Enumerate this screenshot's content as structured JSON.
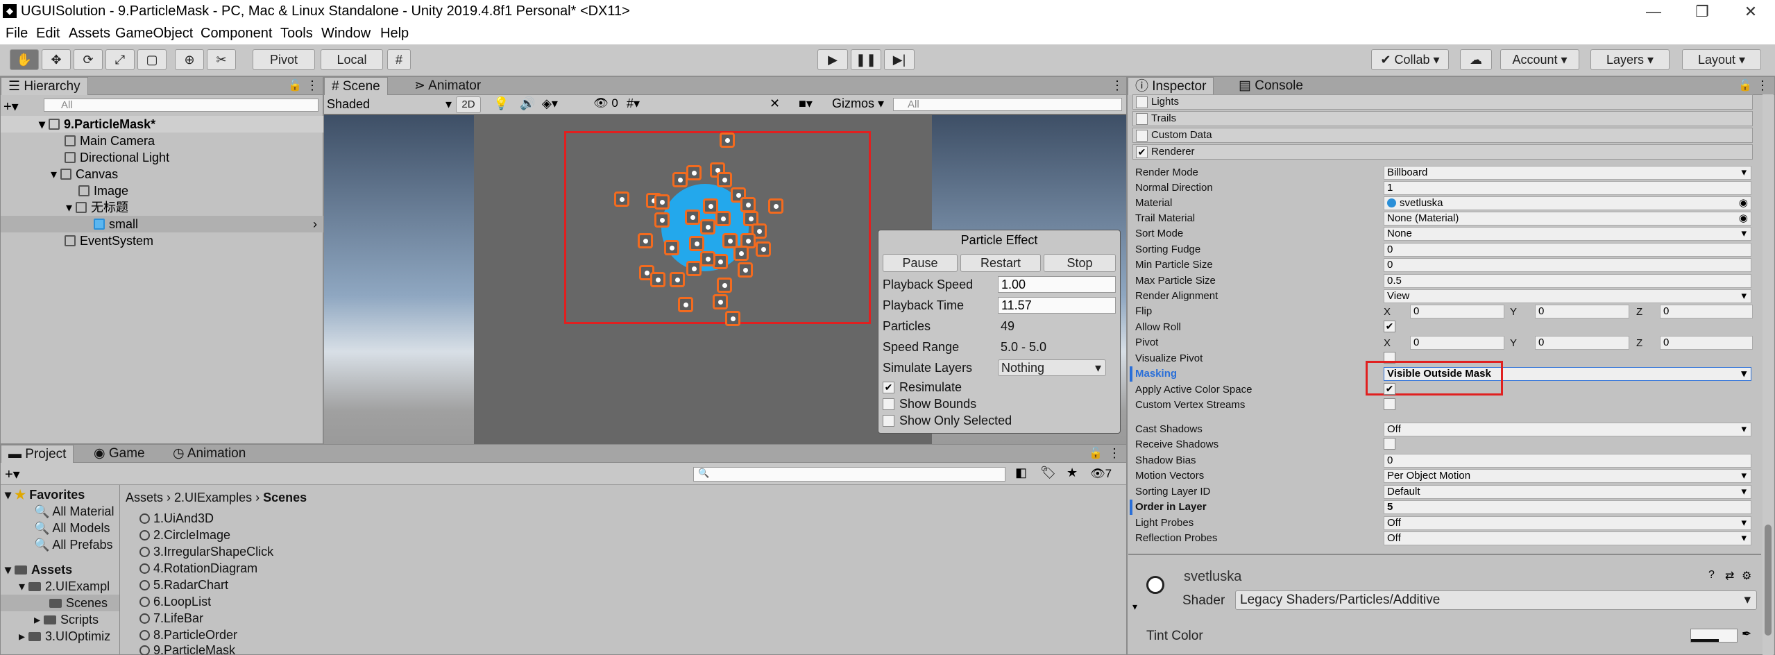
{
  "window": {
    "title": "UGUISolution - 9.ParticleMask - PC, Mac & Linux Standalone - Unity 2019.4.8f1 Personal* <DX11>"
  },
  "menu": [
    "File",
    "Edit",
    "Assets",
    "GameObject",
    "Component",
    "Tools",
    "Window",
    "Help"
  ],
  "toolbar": {
    "pivot": "Pivot",
    "local": "Local",
    "collab": "Collab",
    "account": "Account",
    "layers": "Layers",
    "layout": "Layout"
  },
  "hierarchy": {
    "tab": "Hierarchy",
    "search_placeholder": "All",
    "scene": "9.ParticleMask*",
    "items": [
      "Main Camera",
      "Directional Light",
      "Canvas",
      "Image",
      "无标题",
      "small",
      "EventSystem"
    ]
  },
  "scene_view": {
    "tabs": [
      "Scene",
      "Animator"
    ],
    "shading": "Shaded",
    "mode_2d": "2D",
    "hidden_count": "0",
    "gizmos": "Gizmos",
    "search_placeholder": "All"
  },
  "particle_effect": {
    "title": "Particle Effect",
    "buttons": [
      "Pause",
      "Restart",
      "Stop"
    ],
    "playback_speed_label": "Playback Speed",
    "playback_speed": "1.00",
    "playback_time_label": "Playback Time",
    "playback_time": "11.57",
    "particles_label": "Particles",
    "particles": "49",
    "speed_range_label": "Speed Range",
    "speed_range": "5.0 - 5.0",
    "simulate_layers_label": "Simulate Layers",
    "simulate_layers": "Nothing",
    "resimulate": "Resimulate",
    "show_bounds": "Show Bounds",
    "show_only_selected": "Show Only Selected"
  },
  "project": {
    "tabs": [
      "Project",
      "Game",
      "Animation"
    ],
    "hidden_count": "7",
    "favorites": "Favorites",
    "favorite_items": [
      "All Material",
      "All Models",
      "All Prefabs"
    ],
    "assets": "Assets",
    "tree": [
      "2.UIExampl",
      "Scenes",
      "Scripts",
      "3.UIOptimiz"
    ],
    "breadcrumb": [
      "Assets",
      "2.UIExamples",
      "Scenes"
    ],
    "files": [
      "1.UiAnd3D",
      "2.CircleImage",
      "3.IrregularShapeClick",
      "4.RotationDiagram",
      "5.RadarChart",
      "6.LoopList",
      "7.LifeBar",
      "8.ParticleOrder",
      "9.ParticleMask"
    ]
  },
  "inspector": {
    "tabs": [
      "Inspector",
      "Console"
    ],
    "modules": [
      "Lights",
      "Trails",
      "Custom Data",
      "Renderer"
    ],
    "render_mode_label": "Render Mode",
    "render_mode": "Billboard",
    "normal_direction_label": "Normal Direction",
    "normal_direction": "1",
    "material_label": "Material",
    "material": "svetluska",
    "trail_material_label": "Trail Material",
    "trail_material": "None (Material)",
    "sort_mode_label": "Sort Mode",
    "sort_mode": "None",
    "sorting_fudge_label": "Sorting Fudge",
    "sorting_fudge": "0",
    "min_particle_size_label": "Min Particle Size",
    "min_particle_size": "0",
    "max_particle_size_label": "Max Particle Size",
    "max_particle_size": "0.5",
    "render_alignment_label": "Render Alignment",
    "render_alignment": "View",
    "flip_label": "Flip",
    "flip": {
      "x": "0",
      "y": "0",
      "z": "0"
    },
    "allow_roll_label": "Allow Roll",
    "pivot_label": "Pivot",
    "pivot": {
      "x": "0",
      "y": "0",
      "z": "0"
    },
    "visualize_pivot_label": "Visualize Pivot",
    "masking_label": "Masking",
    "masking": "Visible Outside Mask",
    "apply_active_color_space_label": "Apply Active Color Space",
    "custom_vertex_streams_label": "Custom Vertex Streams",
    "cast_shadows_label": "Cast Shadows",
    "cast_shadows": "Off",
    "receive_shadows_label": "Receive Shadows",
    "shadow_bias_label": "Shadow Bias",
    "shadow_bias": "0",
    "motion_vectors_label": "Motion Vectors",
    "motion_vectors": "Per Object Motion",
    "sorting_layer_id_label": "Sorting Layer ID",
    "sorting_layer_id": "Default",
    "order_in_layer_label": "Order in Layer",
    "order_in_layer": "5",
    "light_probes_label": "Light Probes",
    "light_probes": "Off",
    "reflection_probes_label": "Reflection Probes",
    "reflection_probes": "Off",
    "material_name": "svetluska",
    "shader_label": "Shader",
    "shader": "Legacy Shaders/Particles/Additive",
    "tint_color_label": "Tint Color",
    "axis": {
      "x": "X",
      "y": "Y",
      "z": "Z"
    }
  }
}
